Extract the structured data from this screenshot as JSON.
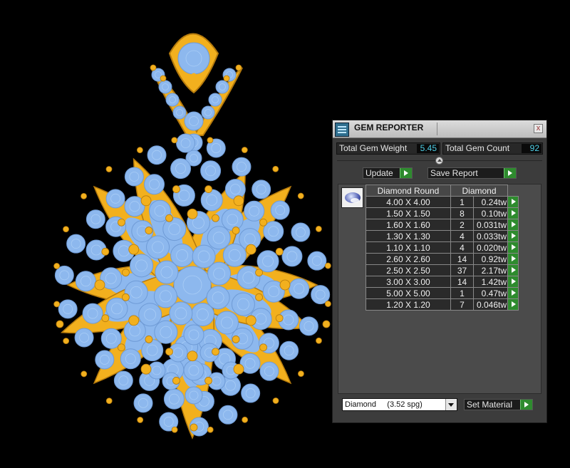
{
  "panel": {
    "title": "GEM REPORTER",
    "close_label": "x",
    "total_gem_weight_label": "Total Gem Weight",
    "total_gem_weight": "5.45",
    "total_gem_count_label": "Total Gem Count",
    "total_gem_count": "92",
    "update_label": "Update",
    "save_report_label": "Save Report",
    "table": {
      "headers": [
        "Diamond Round",
        "Diamond"
      ],
      "rows": [
        {
          "size": "4.00 X 4.00",
          "count": "1",
          "weight": "0.24tw"
        },
        {
          "size": "1.50 X 1.50",
          "count": "8",
          "weight": "0.10tw"
        },
        {
          "size": "1.60 X 1.60",
          "count": "2",
          "weight": "0.031tw"
        },
        {
          "size": "1.30 X 1.30",
          "count": "4",
          "weight": "0.033tw"
        },
        {
          "size": "1.10 X 1.10",
          "count": "4",
          "weight": "0.020tw"
        },
        {
          "size": "2.60 X 2.60",
          "count": "14",
          "weight": "0.92tw"
        },
        {
          "size": "2.50 X 2.50",
          "count": "37",
          "weight": "2.17tw"
        },
        {
          "size": "3.00 X 3.00",
          "count": "14",
          "weight": "1.42tw"
        },
        {
          "size": "5.00 X 5.00",
          "count": "1",
          "weight": "0.47tw"
        },
        {
          "size": "1.20 X 1.20",
          "count": "7",
          "weight": "0.046tw"
        }
      ]
    },
    "material_select_value": "Diamond     (3.52 spg)",
    "set_material_label": "Set Material"
  },
  "colors": {
    "gold": "#f2b01e",
    "gem_blue": "#8db8ee",
    "value_cyan": "#4fd0e8",
    "go_green": "#2e8b2e"
  }
}
